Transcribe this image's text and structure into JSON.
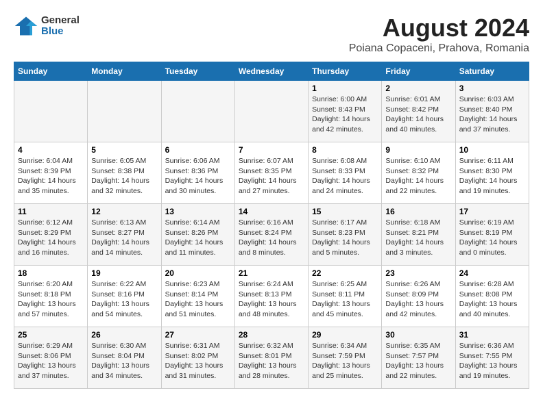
{
  "logo": {
    "general": "General",
    "blue": "Blue"
  },
  "title": "August 2024",
  "subtitle": "Poiana Copaceni, Prahova, Romania",
  "days_of_week": [
    "Sunday",
    "Monday",
    "Tuesday",
    "Wednesday",
    "Thursday",
    "Friday",
    "Saturday"
  ],
  "weeks": [
    [
      {
        "day": "",
        "info": ""
      },
      {
        "day": "",
        "info": ""
      },
      {
        "day": "",
        "info": ""
      },
      {
        "day": "",
        "info": ""
      },
      {
        "day": "1",
        "info": "Sunrise: 6:00 AM\nSunset: 8:43 PM\nDaylight: 14 hours\nand 42 minutes."
      },
      {
        "day": "2",
        "info": "Sunrise: 6:01 AM\nSunset: 8:42 PM\nDaylight: 14 hours\nand 40 minutes."
      },
      {
        "day": "3",
        "info": "Sunrise: 6:03 AM\nSunset: 8:40 PM\nDaylight: 14 hours\nand 37 minutes."
      }
    ],
    [
      {
        "day": "4",
        "info": "Sunrise: 6:04 AM\nSunset: 8:39 PM\nDaylight: 14 hours\nand 35 minutes."
      },
      {
        "day": "5",
        "info": "Sunrise: 6:05 AM\nSunset: 8:38 PM\nDaylight: 14 hours\nand 32 minutes."
      },
      {
        "day": "6",
        "info": "Sunrise: 6:06 AM\nSunset: 8:36 PM\nDaylight: 14 hours\nand 30 minutes."
      },
      {
        "day": "7",
        "info": "Sunrise: 6:07 AM\nSunset: 8:35 PM\nDaylight: 14 hours\nand 27 minutes."
      },
      {
        "day": "8",
        "info": "Sunrise: 6:08 AM\nSunset: 8:33 PM\nDaylight: 14 hours\nand 24 minutes."
      },
      {
        "day": "9",
        "info": "Sunrise: 6:10 AM\nSunset: 8:32 PM\nDaylight: 14 hours\nand 22 minutes."
      },
      {
        "day": "10",
        "info": "Sunrise: 6:11 AM\nSunset: 8:30 PM\nDaylight: 14 hours\nand 19 minutes."
      }
    ],
    [
      {
        "day": "11",
        "info": "Sunrise: 6:12 AM\nSunset: 8:29 PM\nDaylight: 14 hours\nand 16 minutes."
      },
      {
        "day": "12",
        "info": "Sunrise: 6:13 AM\nSunset: 8:27 PM\nDaylight: 14 hours\nand 14 minutes."
      },
      {
        "day": "13",
        "info": "Sunrise: 6:14 AM\nSunset: 8:26 PM\nDaylight: 14 hours\nand 11 minutes."
      },
      {
        "day": "14",
        "info": "Sunrise: 6:16 AM\nSunset: 8:24 PM\nDaylight: 14 hours\nand 8 minutes."
      },
      {
        "day": "15",
        "info": "Sunrise: 6:17 AM\nSunset: 8:23 PM\nDaylight: 14 hours\nand 5 minutes."
      },
      {
        "day": "16",
        "info": "Sunrise: 6:18 AM\nSunset: 8:21 PM\nDaylight: 14 hours\nand 3 minutes."
      },
      {
        "day": "17",
        "info": "Sunrise: 6:19 AM\nSunset: 8:19 PM\nDaylight: 14 hours\nand 0 minutes."
      }
    ],
    [
      {
        "day": "18",
        "info": "Sunrise: 6:20 AM\nSunset: 8:18 PM\nDaylight: 13 hours\nand 57 minutes."
      },
      {
        "day": "19",
        "info": "Sunrise: 6:22 AM\nSunset: 8:16 PM\nDaylight: 13 hours\nand 54 minutes."
      },
      {
        "day": "20",
        "info": "Sunrise: 6:23 AM\nSunset: 8:14 PM\nDaylight: 13 hours\nand 51 minutes."
      },
      {
        "day": "21",
        "info": "Sunrise: 6:24 AM\nSunset: 8:13 PM\nDaylight: 13 hours\nand 48 minutes."
      },
      {
        "day": "22",
        "info": "Sunrise: 6:25 AM\nSunset: 8:11 PM\nDaylight: 13 hours\nand 45 minutes."
      },
      {
        "day": "23",
        "info": "Sunrise: 6:26 AM\nSunset: 8:09 PM\nDaylight: 13 hours\nand 42 minutes."
      },
      {
        "day": "24",
        "info": "Sunrise: 6:28 AM\nSunset: 8:08 PM\nDaylight: 13 hours\nand 40 minutes."
      }
    ],
    [
      {
        "day": "25",
        "info": "Sunrise: 6:29 AM\nSunset: 8:06 PM\nDaylight: 13 hours\nand 37 minutes."
      },
      {
        "day": "26",
        "info": "Sunrise: 6:30 AM\nSunset: 8:04 PM\nDaylight: 13 hours\nand 34 minutes."
      },
      {
        "day": "27",
        "info": "Sunrise: 6:31 AM\nSunset: 8:02 PM\nDaylight: 13 hours\nand 31 minutes."
      },
      {
        "day": "28",
        "info": "Sunrise: 6:32 AM\nSunset: 8:01 PM\nDaylight: 13 hours\nand 28 minutes."
      },
      {
        "day": "29",
        "info": "Sunrise: 6:34 AM\nSunset: 7:59 PM\nDaylight: 13 hours\nand 25 minutes."
      },
      {
        "day": "30",
        "info": "Sunrise: 6:35 AM\nSunset: 7:57 PM\nDaylight: 13 hours\nand 22 minutes."
      },
      {
        "day": "31",
        "info": "Sunrise: 6:36 AM\nSunset: 7:55 PM\nDaylight: 13 hours\nand 19 minutes."
      }
    ]
  ]
}
